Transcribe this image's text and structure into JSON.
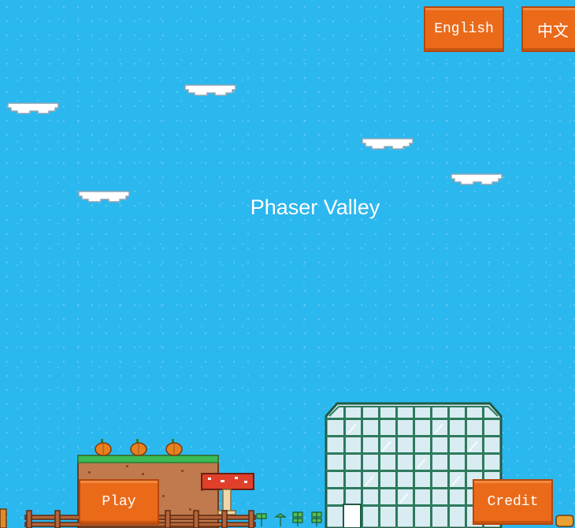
{
  "game": {
    "title": "Phaser Valley"
  },
  "language_menu": {
    "english_label": "English",
    "chinese_label": "中文"
  },
  "main_menu": {
    "play_label": "Play",
    "credit_label": "Credit"
  },
  "colors": {
    "sky": "#2bb8ef",
    "button_fill": "#ea6a1a",
    "button_border": "#b4470c",
    "dirt": "#c07a4d",
    "grass": "#3dbb55",
    "greenhouse_frame": "#2e7a5e"
  },
  "sprites": {
    "clouds": [
      "cloud-icon",
      "cloud-icon",
      "cloud-icon",
      "cloud-icon",
      "cloud-icon",
      "cloud-icon"
    ],
    "pumpkins": [
      "pumpkin-icon",
      "pumpkin-icon",
      "pumpkin-icon"
    ],
    "props": [
      "mushroom-table-icon",
      "greenhouse-icon",
      "fence-icon",
      "sprout-icon",
      "hay-bale-icon"
    ]
  }
}
